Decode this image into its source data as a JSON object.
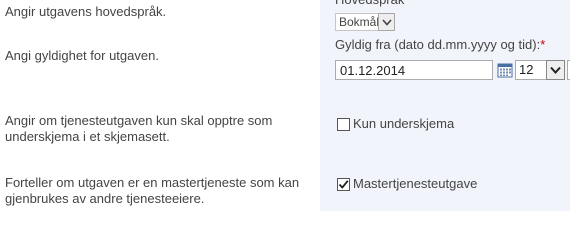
{
  "descriptions": {
    "language": "Angir utgavens hovedspråk.",
    "validity": "Angi gyldighet for utgaven.",
    "subform_line1": "Angir om tjenesteutgaven kun skal opptre som",
    "subform_line2": "underskjema i et skjemasett.",
    "master_line1": "Forteller om utgaven er en mastertjeneste som kan",
    "master_line2": "gjenbrukes av andre tjenesteeiere."
  },
  "language_field": {
    "label": "Hovedspråk",
    "selected": "Bokmål"
  },
  "validity_field": {
    "label": "Gyldig fra (dato dd.mm.yyyy og tid):",
    "required_marker": "*",
    "date_value": "01.12.2014",
    "hour_selected": "12"
  },
  "subform_checkbox": {
    "label": "Kun underskjema",
    "checked": false
  },
  "master_checkbox": {
    "label": "Mastertjenesteutgave",
    "checked": true
  },
  "icons": {
    "calendar": "calendar-icon",
    "dropdown": "chevron-down-icon",
    "check": "checkmark-icon"
  }
}
